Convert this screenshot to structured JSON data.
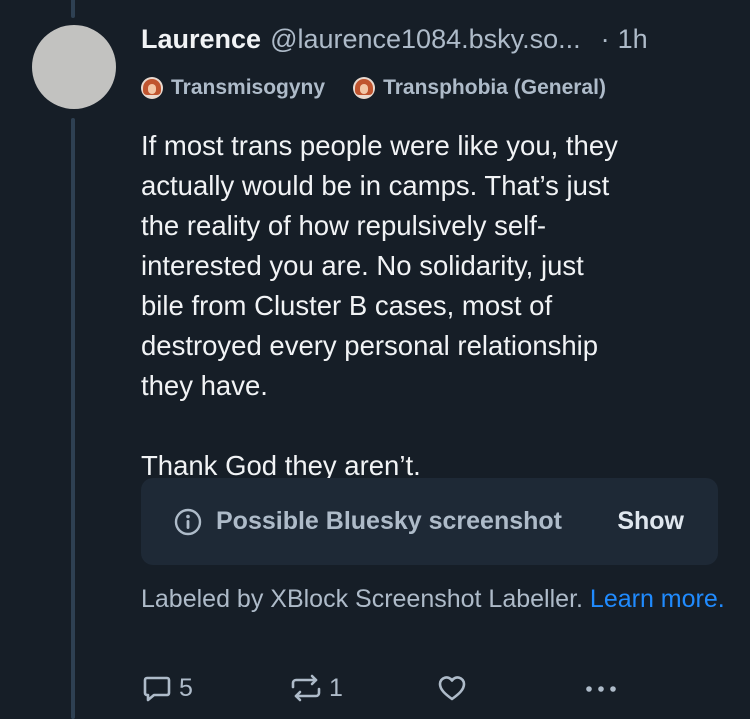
{
  "post": {
    "author_name": "Laurence",
    "author_handle": "@laurence1084.bsky.so...",
    "dot": "·",
    "time": "1h",
    "labels": [
      {
        "text": "Transmisogyny",
        "icon": "labeler-avatar-icon"
      },
      {
        "text": "Transphobia (General)",
        "icon": "labeler-avatar-icon"
      }
    ],
    "text": "If most trans people were like you, they\nactually would be in camps. That’s just\nthe reality of how repulsively self-\ninterested you are. No solidarity, just\nbile from Cluster B cases, most of\ndestroyed every personal relationship\nthey have.\n\nThank God they aren’t."
  },
  "notice": {
    "icon": "info-icon",
    "text": "Possible Bluesky screenshot",
    "show_label": "Show"
  },
  "labeler_note": {
    "text": "Labeled by XBlock Screenshot Labeller.",
    "link_text": "Learn more."
  },
  "actions": {
    "reply_count": "5",
    "repost_count": "1",
    "like_count": "",
    "icons": [
      "reply-icon",
      "repost-icon",
      "like-icon",
      "more-icon"
    ]
  },
  "colors": {
    "background": "#161e27",
    "card": "#1e2936",
    "muted_text": "#aebbc9",
    "link": "#208bfe",
    "thread_line": "#2e4052"
  }
}
